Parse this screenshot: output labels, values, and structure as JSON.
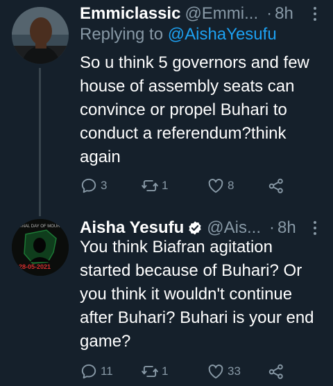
{
  "tweets": [
    {
      "name": "Emmiclassic",
      "handle": "@Emmi...",
      "time": "8h",
      "replying_prefix": "Replying to",
      "replying_to": "@AishaYesufu",
      "text": "So u think 5 governors and few house of assembly seats can convince or propel Buhari to conduct a referendum?think again",
      "replies": "3",
      "retweets": "1",
      "likes": "8"
    },
    {
      "name": "Aisha Yesufu",
      "handle": "@Ais...",
      "time": "8h",
      "verified": true,
      "avatar_text_top": "...INAL DAY OF MOURN...",
      "avatar_date": "28-05-2021",
      "text": "You think Biafran agitation started because of Buhari? Or you think it wouldn't continue after Buhari? Buhari is your end game?",
      "replies": "11",
      "retweets": "1",
      "likes": "33"
    }
  ],
  "icons": [
    "reply-icon",
    "retweet-icon",
    "like-icon",
    "share-icon",
    "more-icon",
    "verified-icon"
  ],
  "colors": {
    "background": "#15202b",
    "muted": "#8899a6",
    "accent": "#1da1f2",
    "divider": "#38444d"
  }
}
